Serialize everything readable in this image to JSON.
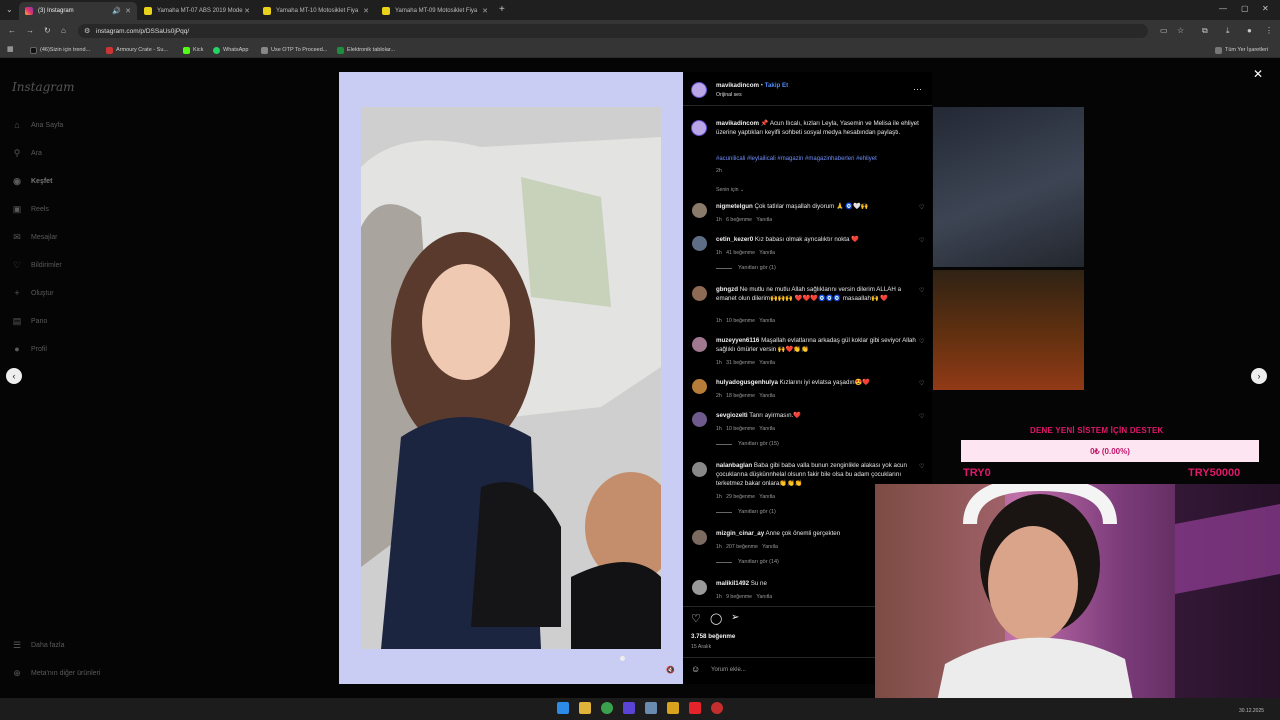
{
  "browser": {
    "tabs": [
      {
        "title": "(3) Instagram",
        "active": true
      },
      {
        "title": "Yamaha MT-07 ABS 2019 Mode",
        "active": false
      },
      {
        "title": "Yamaha MT-10 Motosiklet Fiya",
        "active": false
      },
      {
        "title": "Yamaha MT-09 Motosiklet Fiya",
        "active": false
      }
    ],
    "new_tab": "+",
    "url": "instagram.com/p/DSSaUs0jPqq/",
    "bookmarks": [
      {
        "label": "(46)Sizin için trend..."
      },
      {
        "label": "Armoury Crate - Su..."
      },
      {
        "label": "Kick"
      },
      {
        "label": "WhatsApp"
      },
      {
        "label": "Use OTP To Proceed..."
      },
      {
        "label": "Elektronik tablolar..."
      }
    ],
    "all_bookmarks": "Tüm Yer İşaretleri"
  },
  "instagram": {
    "logo": "Instagram",
    "nav": [
      {
        "label": "Ana Sayfa",
        "icon": "home-icon",
        "glyph": "⌂"
      },
      {
        "label": "Ara",
        "icon": "search-icon",
        "glyph": "⚲"
      },
      {
        "label": "Keşfet",
        "icon": "explore-icon",
        "glyph": "◎"
      },
      {
        "label": "Reels",
        "icon": "reels-icon",
        "glyph": "▣"
      },
      {
        "label": "Mesajlar",
        "icon": "messages-icon",
        "glyph": "✉"
      },
      {
        "label": "Bildirimler",
        "icon": "heart-icon",
        "glyph": "♡"
      },
      {
        "label": "Oluştur",
        "icon": "plus-icon",
        "glyph": "+"
      },
      {
        "label": "Pano",
        "icon": "dashboard-icon",
        "glyph": "▤"
      },
      {
        "label": "Profil",
        "icon": "profile-icon",
        "glyph": "●"
      }
    ],
    "more": "Daha fazla",
    "meta": "Meta'nın diğer ürünleri"
  },
  "post": {
    "username": "mavikadincom",
    "follow": "Takip Et",
    "audio": "Orijinal ses",
    "caption": "📌 Acun Ilıcalı, kızları Leyla, Yasemin ve Melisa ile ehliyet üzerine yaptıkları keyifli sohbeti sosyal medya hesabından paylaştı.",
    "hashtags": "#acunilicali #leylailicali #magazin #magazinhaberleri #ehliyet",
    "caption_time": "2h",
    "sort": "Senin için",
    "likes": "3.758 beğenme",
    "date": "15 Aralık",
    "comment_placeholder": "Yorum ekle...",
    "comments": [
      {
        "user": "nigmetelgun",
        "text": "Çok tatlılar maşallah diyorum 🙏 🧿🤍🙌",
        "time": "1h",
        "likes": "6 beğenme",
        "reply": "Yanıtla",
        "view_replies": ""
      },
      {
        "user": "cetin_kezer0",
        "text": "Kız babası olmak ayrıcalıktır nokta ❤️",
        "time": "1h",
        "likes": "41 beğenme",
        "reply": "Yanıtla",
        "view_replies": "Yanıtları gör (1)"
      },
      {
        "user": "gbngzd",
        "text": "Ne mutlu ne mutlu Allah sağlıklarını versin dilerim ALLAH a emanet olun dilerim🙌🙌🙌 ❤️❤️❤️🧿🧿🧿 masaallah🙌 ❤️",
        "time": "1h",
        "likes": "10 beğenme",
        "reply": "Yanıtla",
        "view_replies": ""
      },
      {
        "user": "muzeyyen6116",
        "text": "Maşallah evlatlarına arkadaş gül koklar gibi seviyor Allah sağlıklı ömürler versin 🙌❤️👏👏",
        "time": "1h",
        "likes": "31 beğenme",
        "reply": "Yanıtla",
        "view_replies": ""
      },
      {
        "user": "hulyadogusgenhulya",
        "text": "Kızlarını iyi evlatsa yaşadın😍❤️",
        "time": "2h",
        "likes": "18 beğenme",
        "reply": "Yanıtla",
        "view_replies": ""
      },
      {
        "user": "sevgiozelti",
        "text": "Tanrı ayirmasın.❤️",
        "time": "1h",
        "likes": "10 beğenme",
        "reply": "Yanıtla",
        "view_replies": "Yanıtları gör (15)"
      },
      {
        "user": "nalanbaglan",
        "text": "Baba gibi baba valla bunun zenginlikle alakası yok acun çocuklarına düşkünnhelal olsunn fakir bile olsa bu adam çocuklarını terketmez bakar onlara👏👏👏",
        "time": "1h",
        "likes": "29 beğenme",
        "reply": "Yanıtla",
        "view_replies": "Yanıtları gör (1)"
      },
      {
        "user": "mizgin_cinar_ay",
        "text": "Anne çok önemli gerçekten",
        "time": "1h",
        "likes": "207 beğenme",
        "reply": "Yanıtla",
        "view_replies": "Yanıtları gör (14)"
      },
      {
        "user": "malikil1492",
        "text": "Su ne",
        "time": "1h",
        "likes": "9 beğenme",
        "reply": "Yanıtla",
        "view_replies": ""
      }
    ]
  },
  "overlay": {
    "donation_title": "DENE YENİ SİSTEM İÇİN DESTEK",
    "donation_progress": "0₺ (0.00%)",
    "goal_left": "TRY0",
    "goal_right": "TRY50000",
    "progress_fraction": 0
  },
  "taskbar": {
    "clock": "30.12.2025"
  }
}
